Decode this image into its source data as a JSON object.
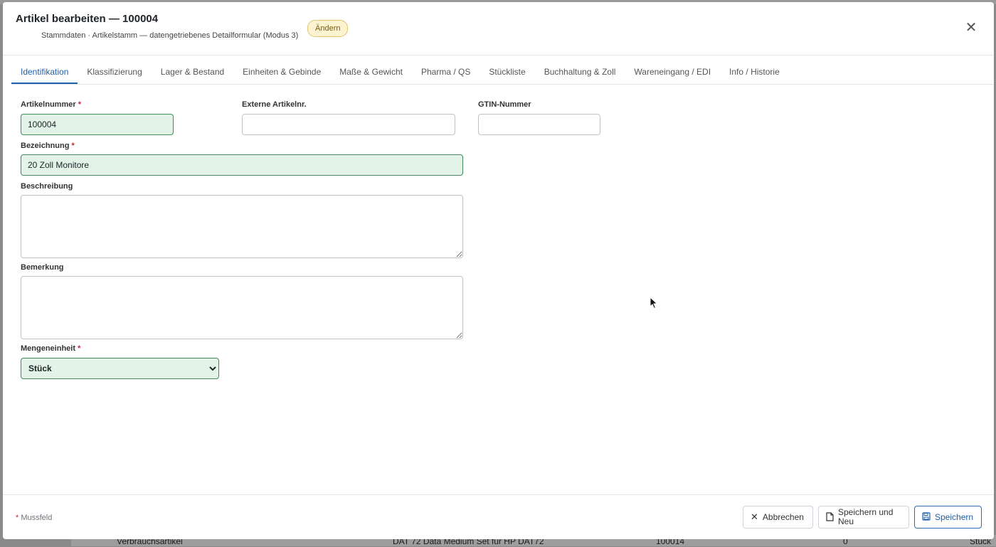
{
  "modal": {
    "title": "Artikel bearbeiten — 100004",
    "subtitle": "Stammdaten · Artikelstamm — datengetriebenes Detailformular (Modus 3)",
    "badge": "Ändern"
  },
  "tabs": [
    {
      "label": "Identifikation",
      "active": true
    },
    {
      "label": "Klassifizierung"
    },
    {
      "label": "Lager & Bestand"
    },
    {
      "label": "Einheiten & Gebinde"
    },
    {
      "label": "Maße & Gewicht"
    },
    {
      "label": "Pharma / QS"
    },
    {
      "label": "Stückliste"
    },
    {
      "label": "Buchhaltung & Zoll"
    },
    {
      "label": "Wareneingang / EDI"
    },
    {
      "label": "Info / Historie"
    }
  ],
  "form": {
    "artikelnummer": {
      "label": "Artikelnummer",
      "value": "100004"
    },
    "externe": {
      "label": "Externe Artikelnr.",
      "value": ""
    },
    "gtin": {
      "label": "GTIN-Nummer",
      "value": ""
    },
    "bezeichnung": {
      "label": "Bezeichnung",
      "value": "20 Zoll Monitore"
    },
    "beschreibung": {
      "label": "Beschreibung",
      "value": ""
    },
    "bemerkung": {
      "label": "Bemerkung",
      "value": ""
    },
    "mengeneinheit": {
      "label": "Mengeneinheit",
      "value": "Stück"
    },
    "required_marker": "*"
  },
  "footer": {
    "footnote": "Mussfeld",
    "cancel": "Abbrechen",
    "save_new": "Speichern und Neu",
    "save": "Speichern"
  },
  "background_row": {
    "col1": "Verbrauchsartikel",
    "col2": "DAT 72 Data Medium Set für HP DAT72",
    "col3": "100014",
    "col4": "0",
    "col5": "Stück"
  },
  "colors": {
    "accent": "#1f5fa8",
    "required_border": "#3f8c5a",
    "required_bg": "#e3f3e8",
    "badge_bg": "#fdf3d1"
  }
}
